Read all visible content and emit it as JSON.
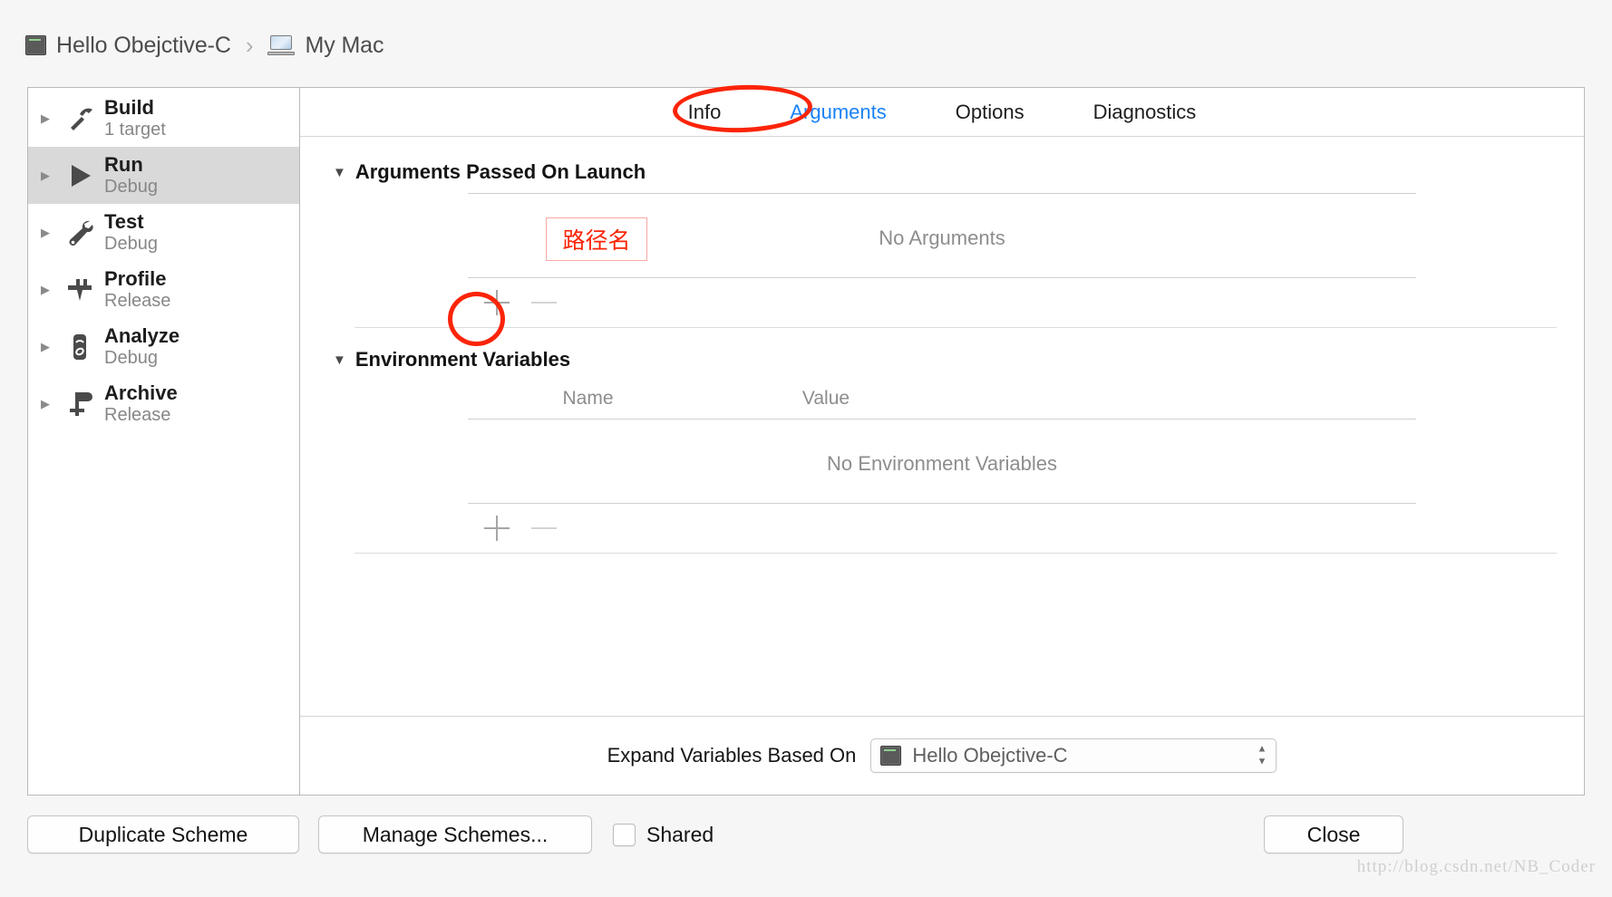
{
  "breadcrumb": {
    "project": "Hello Obejctive-C",
    "separator": "›",
    "destination": "My Mac"
  },
  "sidebar": {
    "items": [
      {
        "title": "Build",
        "subtitle": "1 target",
        "icon": "hammer-icon",
        "selected": false
      },
      {
        "title": "Run",
        "subtitle": "Debug",
        "icon": "play-icon",
        "selected": true
      },
      {
        "title": "Test",
        "subtitle": "Debug",
        "icon": "wrench-icon",
        "selected": false
      },
      {
        "title": "Profile",
        "subtitle": "Release",
        "icon": "caliper-icon",
        "selected": false
      },
      {
        "title": "Analyze",
        "subtitle": "Debug",
        "icon": "stethoscope-icon",
        "selected": false
      },
      {
        "title": "Archive",
        "subtitle": "Release",
        "icon": "archive-icon",
        "selected": false
      }
    ]
  },
  "tabs": [
    {
      "label": "Info",
      "active": false
    },
    {
      "label": "Arguments",
      "active": true
    },
    {
      "label": "Options",
      "active": false
    },
    {
      "label": "Diagnostics",
      "active": false
    }
  ],
  "arguments_section": {
    "title": "Arguments Passed On Launch",
    "empty_text": "No Arguments",
    "add_label": "+",
    "remove_label": "−"
  },
  "environment_section": {
    "title": "Environment Variables",
    "columns": {
      "name": "Name",
      "value": "Value"
    },
    "empty_text": "No Environment Variables",
    "add_label": "+",
    "remove_label": "−"
  },
  "expand_variables": {
    "label": "Expand Variables Based On",
    "selected": "Hello Obejctive-C"
  },
  "footer": {
    "duplicate_scheme": "Duplicate Scheme",
    "manage_schemes": "Manage Schemes...",
    "shared_label": "Shared",
    "shared_checked": false,
    "close": "Close"
  },
  "watermark": "http://blog.csdn.net/NB_Coder",
  "annotations": {
    "path_label": "路径名",
    "color": "#fb2408"
  },
  "colors": {
    "accent_blue": "#1a82f7",
    "annotation_red": "#fb2408",
    "selected_row": "#d9d9d9"
  }
}
